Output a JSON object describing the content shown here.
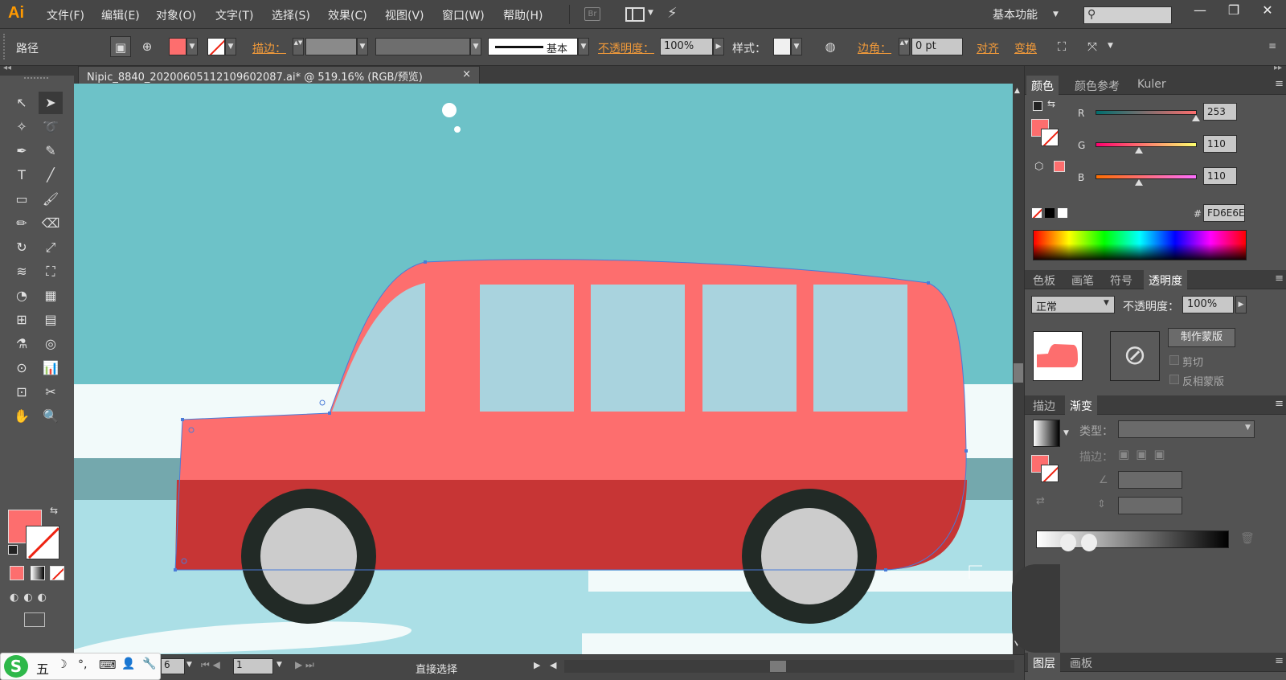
{
  "app": {
    "logo": "Ai"
  },
  "menu": [
    "文件(F)",
    "编辑(E)",
    "对象(O)",
    "文字(T)",
    "选择(S)",
    "效果(C)",
    "视图(V)",
    "窗口(W)",
    "帮助(H)"
  ],
  "menu_br": "Br",
  "workspace": "基本功能",
  "window_controls": {
    "minimize": "—",
    "restore": "❐",
    "close": "✕"
  },
  "control": {
    "path_label": "路径",
    "stroke_label": "描边：",
    "stroke_style": "基本",
    "opacity_label": "不透明度：",
    "opacity_value": "100%",
    "style_label": "样式：",
    "corner_label": "边角：",
    "corner_value": "0 pt",
    "align_label": "对齐",
    "transform_label": "变换",
    "fill_color": "#fd6e6e"
  },
  "document": {
    "tab_title": "Nipic_8840_20200605112109602087.ai* @ 519.16% (RGB/预览)",
    "close": "×"
  },
  "status": {
    "zoom": "6",
    "page": "1",
    "tool_name": "直接选择"
  },
  "ime": {
    "logo": "S",
    "mode": "五",
    "icons": [
      "☽",
      "°,",
      "⌨",
      "👤",
      "🔧"
    ]
  },
  "color_panel": {
    "tabs": [
      "颜色",
      "颜色参考",
      "Kuler"
    ],
    "r_label": "R",
    "g_label": "G",
    "b_label": "B",
    "r": "253",
    "g": "110",
    "b": "110",
    "r_frac": 0.992,
    "g_frac": 0.431,
    "b_frac": 0.431,
    "hex_label": "#",
    "hex": "FD6E6E"
  },
  "transparency_panel": {
    "tabs": [
      "色板",
      "画笔",
      "符号",
      "透明度"
    ],
    "blend_mode": "正常",
    "opacity_label": "不透明度：",
    "opacity_value": "100%",
    "make_mask": "制作蒙版",
    "clip": "剪切",
    "invert_mask": "反相蒙版"
  },
  "gradient_panel": {
    "tabs": [
      "描边",
      "渐变"
    ],
    "type_label": "类型：",
    "stroke_label": "描边："
  },
  "bottom_panel": {
    "tabs": [
      "图层",
      "画板"
    ]
  },
  "colors": {
    "sky": "#6dc2c8",
    "bus_body": "#fd6e6e",
    "bus_lower": "#c73535",
    "window": "#a9d3de",
    "tire": "#222a26",
    "hub": "#cccccc",
    "road_dark": "#74a8ad",
    "snow": "#f2fafa",
    "ground": "#abdfe6"
  }
}
